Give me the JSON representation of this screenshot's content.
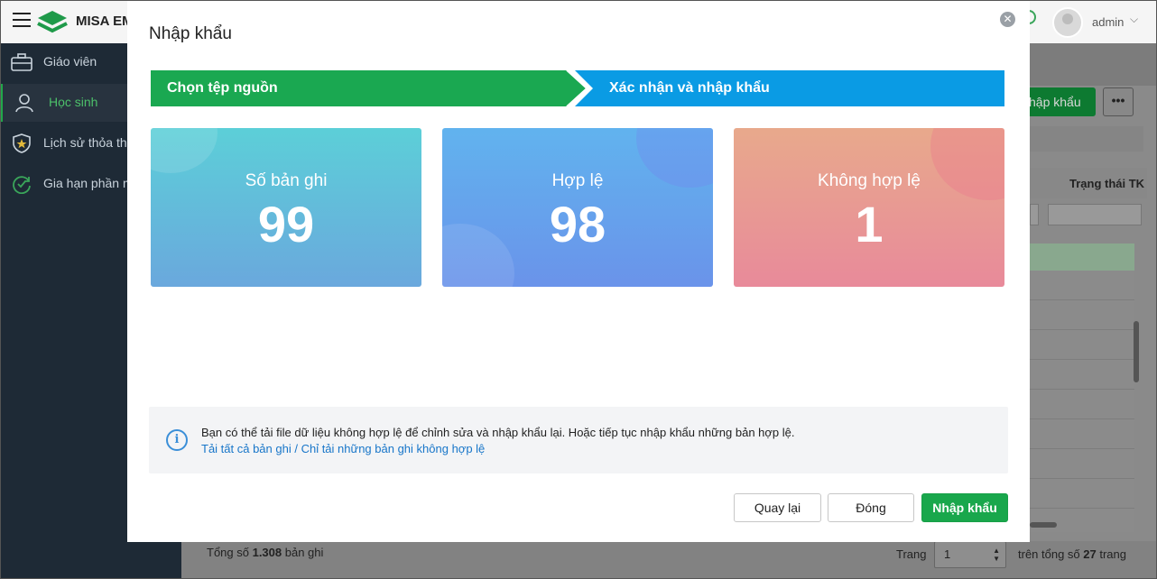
{
  "app": {
    "brand": "MISA EM",
    "user": "admin"
  },
  "sidebar": {
    "items": [
      {
        "label": "Giáo viên",
        "icon": "briefcase-icon"
      },
      {
        "label": "Học sinh",
        "icon": "student-icon"
      },
      {
        "label": "Lịch sử thỏa thuận",
        "icon": "shield-star-icon"
      },
      {
        "label": "Gia hạn phần mềm",
        "icon": "refresh-check-icon"
      }
    ]
  },
  "background": {
    "import_button": "hập khẩu",
    "more_button": "•••",
    "column_title": "Trạng thái TK"
  },
  "footer": {
    "total_prefix": "Tổng số ",
    "total_count": "1.308",
    "total_suffix": " bản ghi",
    "page_label": "Trang",
    "page_value": "1",
    "of_prefix": "trên tổng số ",
    "of_count": "27",
    "of_suffix": " trang"
  },
  "modal": {
    "title": "Nhập khẩu",
    "steps": [
      {
        "label": "Chọn tệp nguồn",
        "color": "#1aa851"
      },
      {
        "label": "Xác nhận và nhập khẩu",
        "color": "#0a9be4"
      }
    ],
    "cards": [
      {
        "label": "Số bản ghi",
        "value": "99"
      },
      {
        "label": "Hợp lệ",
        "value": "98"
      },
      {
        "label": "Không hợp lệ",
        "value": "1"
      }
    ],
    "info": {
      "text": "Bạn có thể tải file dữ liệu không hợp lệ để chỉnh sửa và nhập khẩu lại. Hoặc tiếp tục nhập khẩu những bản hợp lệ.",
      "link_all": "Tải tất cả bản ghi",
      "separator": " / ",
      "link_invalid": "Chỉ tải những bản ghi không hợp lệ"
    },
    "buttons": {
      "back": "Quay lại",
      "close": "Đóng",
      "import": "Nhập khẩu"
    }
  },
  "colors": {
    "accent_green": "#19a74c",
    "accent_blue": "#0a9be4",
    "link_blue": "#1876c9"
  }
}
